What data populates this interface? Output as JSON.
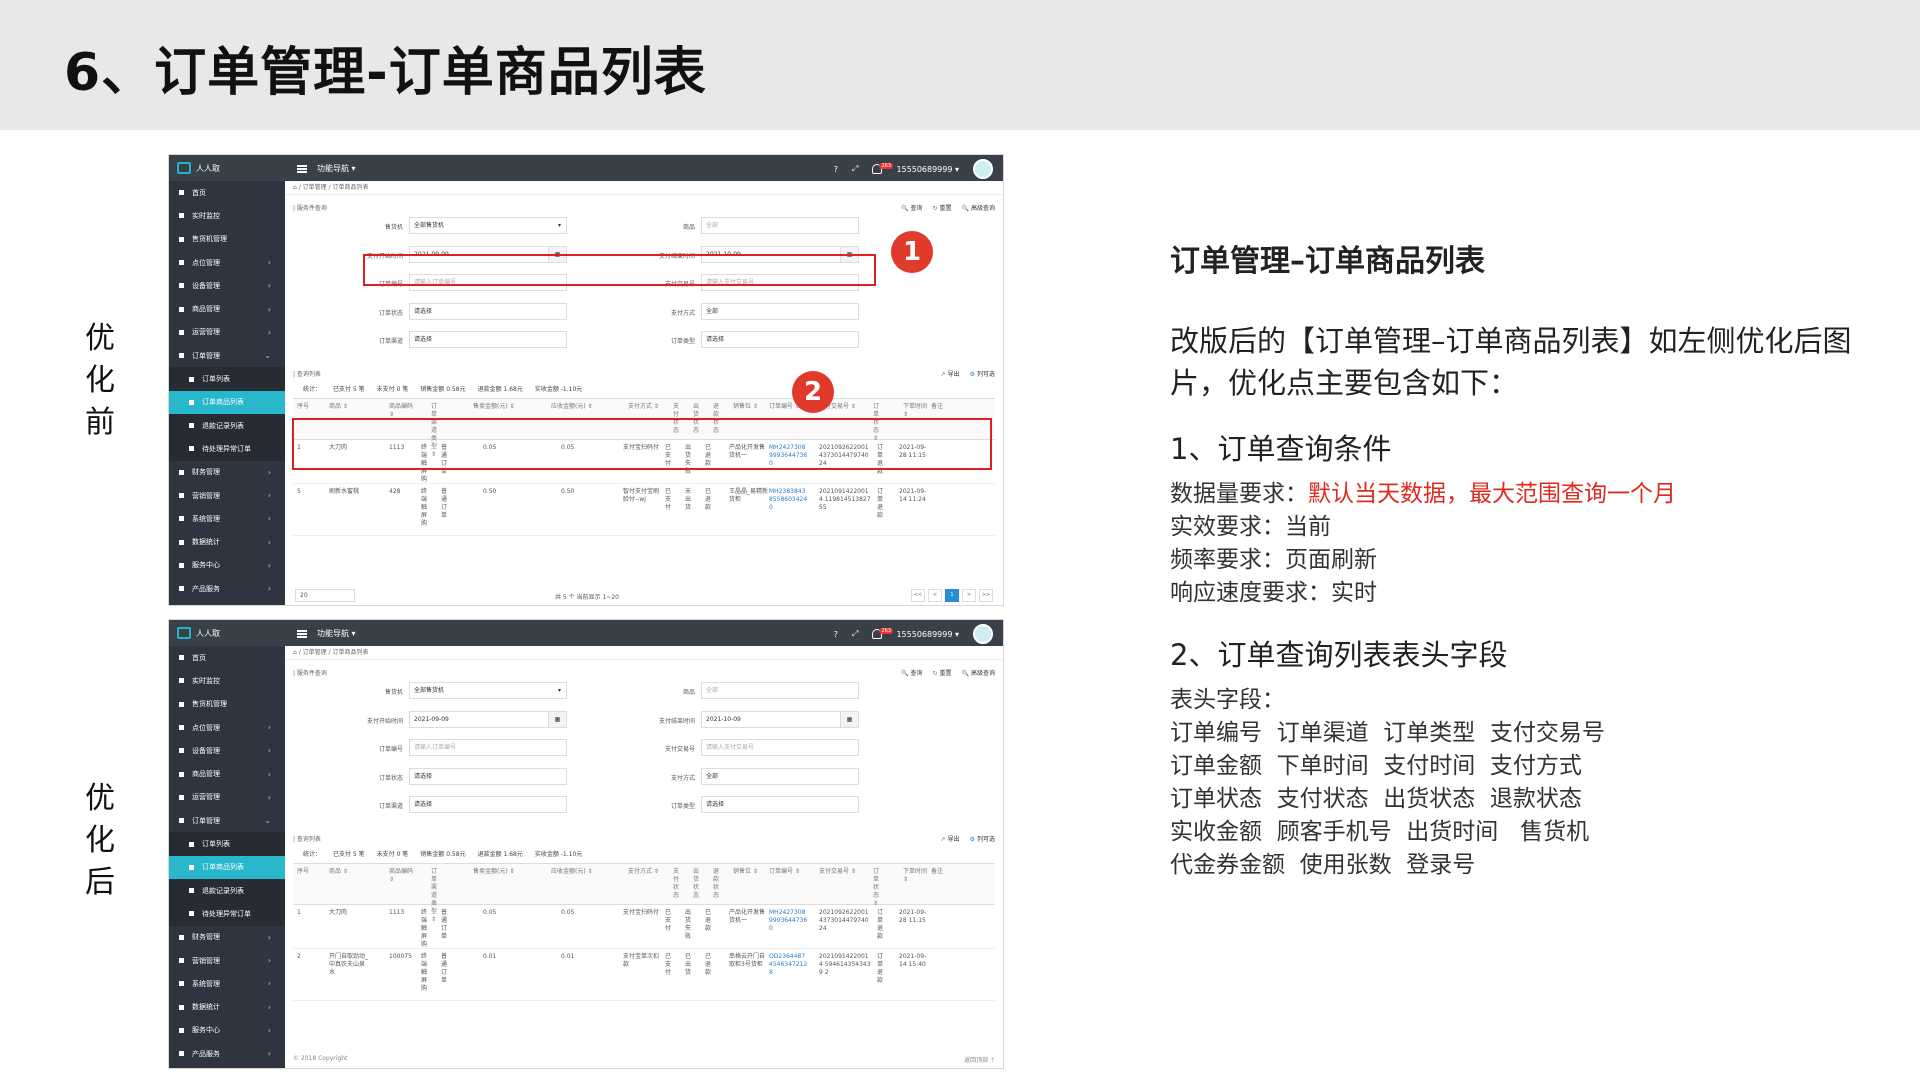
{
  "slide_title": "6、订单管理-订单商品列表",
  "label_before": [
    "优",
    "化",
    "前"
  ],
  "label_after": [
    "优",
    "化",
    "后"
  ],
  "markers": [
    "1",
    "2"
  ],
  "app": {
    "brand": "人人取",
    "nav_menu": "功能导航 ▾",
    "badge": "263",
    "phone": "15550689999 ▾",
    "help": "?",
    "expand": "⤢"
  },
  "sidebar": {
    "items": [
      {
        "label": "首页",
        "arrow": ""
      },
      {
        "label": "实时监控",
        "arrow": ""
      },
      {
        "label": "售货机管理",
        "arrow": ""
      },
      {
        "label": "点位管理",
        "arrow": "›"
      },
      {
        "label": "设备管理",
        "arrow": "›"
      },
      {
        "label": "商品管理",
        "arrow": "›"
      },
      {
        "label": "运营管理",
        "arrow": "›"
      },
      {
        "label": "订单管理",
        "arrow": "⌄"
      },
      {
        "label": "订单列表",
        "arrow": "",
        "sub": true
      },
      {
        "label": "订单商品列表",
        "arrow": "",
        "sub": true,
        "active": true
      },
      {
        "label": "退款记录列表",
        "arrow": "",
        "sub": true
      },
      {
        "label": "待处理异常订单",
        "arrow": "",
        "sub": true
      },
      {
        "label": "财务管理",
        "arrow": "›"
      },
      {
        "label": "营销管理",
        "arrow": "›"
      },
      {
        "label": "系统管理",
        "arrow": "›"
      },
      {
        "label": "数据统计",
        "arrow": "›"
      },
      {
        "label": "服务中心",
        "arrow": "›"
      },
      {
        "label": "产品服务",
        "arrow": "›"
      }
    ]
  },
  "page": {
    "crumb": "⌂ / 订单管理 / 订单商品列表",
    "search_title": "| 服务件查询",
    "actions": {
      "query": "查询",
      "reset": "重置",
      "advanced": "高级查询"
    },
    "form": {
      "vending_label": "售货机",
      "vending_value": "全部售货机",
      "goods_label": "商品",
      "goods_value": "全部",
      "pay_start_label": "支付开始时间",
      "pay_start_value": "2021-09-09",
      "pay_end_label": "支付结束时间",
      "pay_end_value": "2021-10-09",
      "order_no_label": "订单编号",
      "order_no_ph": "请输入订单编号",
      "trade_no_label": "支付交易号",
      "trade_no_ph": "请输入支付交易号",
      "order_status_label": "订单状态",
      "order_status_value": "请选择",
      "pay_method_label": "支付方式",
      "pay_method_value": "全部",
      "channel_label": "订单渠道",
      "channel_value": "请选择",
      "order_type_label": "订单类型",
      "order_type_value": "请选择"
    },
    "list_title": "| 查询列表",
    "list_actions": {
      "export": "导出",
      "columns": "列可选"
    },
    "stats": [
      "统计：",
      "已支付 5 笔",
      "未支付 0 笔",
      "销售金额 0.58元",
      "退款金额 1.68元",
      "实收金额 -1.10元"
    ],
    "headers": [
      "序号",
      "商品 ⇕",
      "商品编码 ⇕",
      "订单渠道类型 ⇕",
      "售卖金额(元) ⇕",
      "应收金额(元) ⇕",
      "支付方式 ⇕",
      "支付状态",
      "出货状态",
      "退款状态",
      "销售位 ⇕",
      "订单编号 ⇕",
      "支付交易号 ⇕",
      "订单状态 ⇕",
      "下单时间 ⇕",
      "备注"
    ],
    "rows_before": [
      [
        "1",
        "大刀肉",
        "1113",
        "终端触屏购",
        "普通订单",
        "0.05",
        "0.05",
        "支付宝扫码付",
        "已支付",
        "出货失败",
        "已退款",
        "产品化开发售货机一",
        "MH2427308 9993644736 0",
        "2021092622001 4373014479740 24",
        "订单退款",
        "2021-09-28 11:15"
      ],
      [
        "5",
        "刷新水蜜桃",
        "428",
        "终端触屏购",
        "普通订单",
        "0.50",
        "0.50",
        "智付支付宝刷脸付--wj",
        "已支付",
        "未出货",
        "已退款",
        "王晶晶_易精新货柜",
        "MH2383843 8558603424 0",
        "20210914220014 11981451382755",
        "订单退款",
        "2021-09-14 11:24"
      ]
    ],
    "rows_after": [
      [
        "1",
        "大刀肉",
        "1113",
        "终端触屏购",
        "普通订单",
        "0.05",
        "0.05",
        "支付宝扫码付",
        "已支付",
        "出货失败",
        "已退款",
        "产品化开发售货机一",
        "MH2427308 9993644736 0",
        "2021092622001 4373014479740 24",
        "订单退款",
        "2021-09-28 11:15"
      ],
      [
        "2",
        "开门自取劲动_中真农夫山泉水",
        "100075",
        "终端触屏购",
        "普通订单",
        "0.01",
        "0.01",
        "支付宝单次扣款",
        "已支付",
        "已出货",
        "已退款",
        "串格云开门自取柜3号货柜",
        "OD2364487 4546347212 8",
        "20210914220014 5946143543439 2",
        "订单退款",
        "2021-09-14 15:40"
      ]
    ],
    "pagination_info": "共 5 个 当前显示 1~20",
    "page_size": "20",
    "pager": [
      "<<",
      "<",
      "1",
      ">",
      ">>"
    ],
    "footer": "© 2018 Copyright",
    "back_top": "返回顶部 ⇡"
  },
  "right": {
    "heading": "订单管理–订单商品列表",
    "intro": "改版后的【订单管理–订单商品列表】如左侧优化后图片，优化点主要包含如下：",
    "sec1_title": "1、订单查询条件",
    "sec1_lines": [
      {
        "k": "数据量要求：",
        "v": "默认当天数据，最大范围查询一个月",
        "red": true
      },
      {
        "k": "实效要求：",
        "v": "当前"
      },
      {
        "k": "频率要求：",
        "v": "页面刷新"
      },
      {
        "k": "响应速度要求：",
        "v": "实时"
      }
    ],
    "sec2_title": "2、订单查询列表表头字段",
    "sec2_lines": [
      "表头字段：",
      "订单编号  订单渠道  订单类型  支付交易号",
      "订单金额  下单时间  支付时间  支付方式",
      "订单状态  支付状态  出货状态  退款状态",
      "实收金额  顾客手机号  出货时间   售货机",
      "代金券金额  使用张数  登录号"
    ]
  }
}
